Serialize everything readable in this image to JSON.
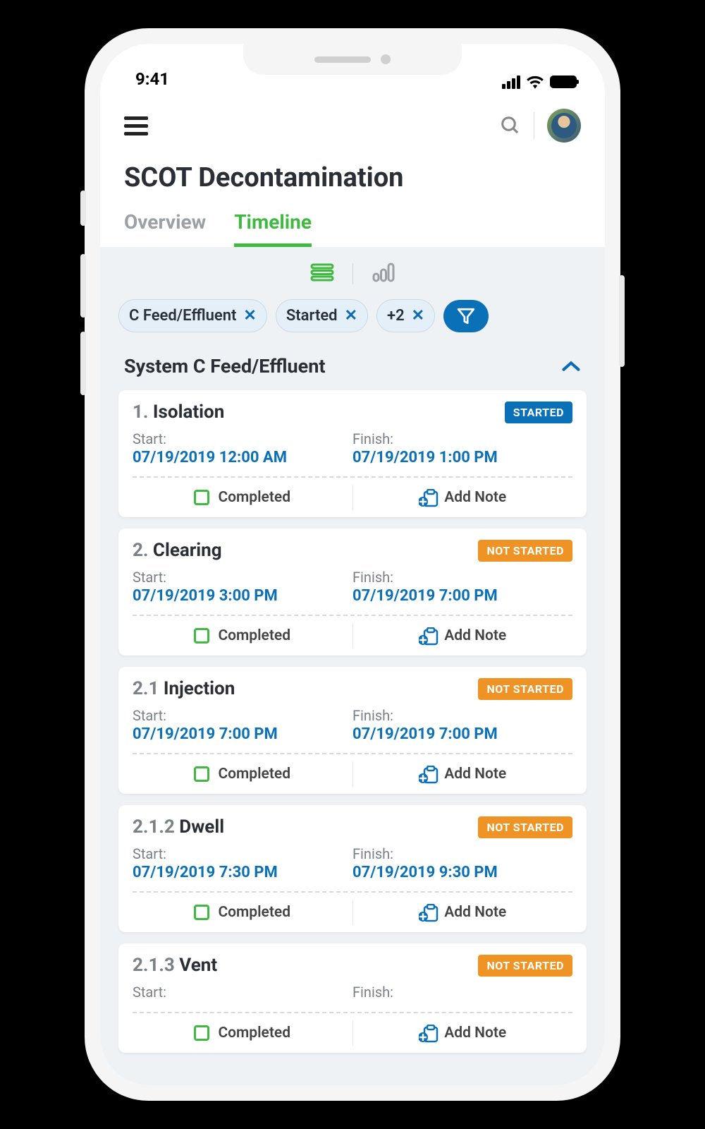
{
  "status_bar": {
    "time": "9:41"
  },
  "page_title": "SCOT Decontamination",
  "tabs": {
    "overview": "Overview",
    "timeline": "Timeline",
    "active": "timeline"
  },
  "filter_chips": [
    {
      "label": "C Feed/Effluent"
    },
    {
      "label": "Started"
    },
    {
      "label": "+2"
    }
  ],
  "section": {
    "title": "System C Feed/Effluent"
  },
  "labels": {
    "start": "Start:",
    "finish": "Finish:",
    "completed": "Completed",
    "add_note": "Add Note"
  },
  "status_badges": {
    "started": "STARTED",
    "not_started": "NOT STARTED"
  },
  "cards": [
    {
      "num": "1.",
      "name": "Isolation",
      "status": "started",
      "start": "07/19/2019 12:00 AM",
      "finish": "07/19/2019 1:00 PM"
    },
    {
      "num": "2.",
      "name": "Clearing",
      "status": "not_started",
      "start": "07/19/2019 3:00 PM",
      "finish": "07/19/2019 7:00 PM"
    },
    {
      "num": "2.1",
      "name": "Injection",
      "status": "not_started",
      "start": "07/19/2019 7:00 PM",
      "finish": "07/19/2019 7:00 PM"
    },
    {
      "num": "2.1.2",
      "name": "Dwell",
      "status": "not_started",
      "start": "07/19/2019 7:30 PM",
      "finish": "07/19/2019 9:30 PM"
    },
    {
      "num": "2.1.3",
      "name": "Vent",
      "status": "not_started",
      "start": "",
      "finish": ""
    }
  ]
}
